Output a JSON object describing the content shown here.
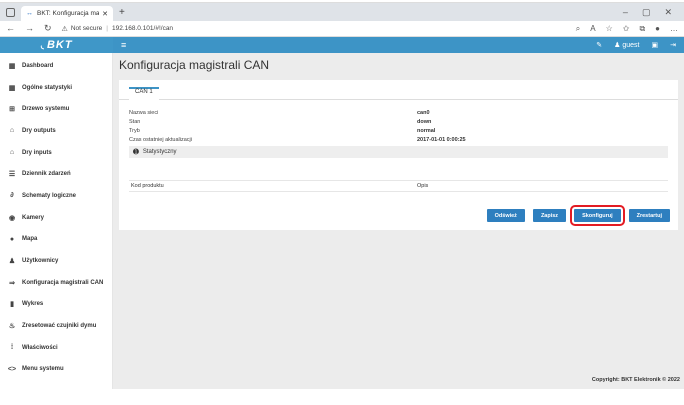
{
  "browser": {
    "tab_title": "BKT: Konfiguracja magistrali CAN",
    "url_warning": "Not secure",
    "url": "192.168.0.101/#!/can"
  },
  "app": {
    "logo": "BKT",
    "user": "guest"
  },
  "sidebar": {
    "items": [
      {
        "label": "Dashboard",
        "icon": "grid-icon"
      },
      {
        "label": "Ogólne statystyki",
        "icon": "grid-icon"
      },
      {
        "label": "Drzewo systemu",
        "icon": "tree-icon"
      },
      {
        "label": "Dry outputs",
        "icon": "output-icon"
      },
      {
        "label": "Dry inputs",
        "icon": "input-icon"
      },
      {
        "label": "Dziennik zdarzeń",
        "icon": "list-icon"
      },
      {
        "label": "Schematy logiczne",
        "icon": "link-icon"
      },
      {
        "label": "Kamery",
        "icon": "camera-icon"
      },
      {
        "label": "Mapa",
        "icon": "pin-icon"
      },
      {
        "label": "Użytkownicy",
        "icon": "user-icon"
      },
      {
        "label": "Konfiguracja magistrali CAN",
        "icon": "can-icon"
      },
      {
        "label": "Wykres",
        "icon": "chart-icon"
      },
      {
        "label": "Zresetować czujniki dymu",
        "icon": "flame-icon"
      },
      {
        "label": "Właściwości",
        "icon": "properties-icon"
      },
      {
        "label": "Menu systemu",
        "icon": "code-icon"
      }
    ]
  },
  "main": {
    "title": "Konfiguracja magistrali CAN",
    "tab": "CAN 1",
    "fields": [
      {
        "key": "Nazwa sieci",
        "value": "can0"
      },
      {
        "key": "Stan",
        "value": "down"
      },
      {
        "key": "Tryb",
        "value": "normal"
      },
      {
        "key": "Czas ostatniej aktualizacji",
        "value": "2017-01-01 0:00:25"
      }
    ],
    "stats_label": "Statystyczny",
    "product_key": "Kod produktu",
    "product_desc": "Opis",
    "buttons": {
      "refresh": "Odśwież",
      "save": "Zapisz",
      "configure": "Skonfiguruj",
      "restart": "Zrestartuj"
    },
    "footer": "Copyright: BKT Elektronik © 2022"
  }
}
